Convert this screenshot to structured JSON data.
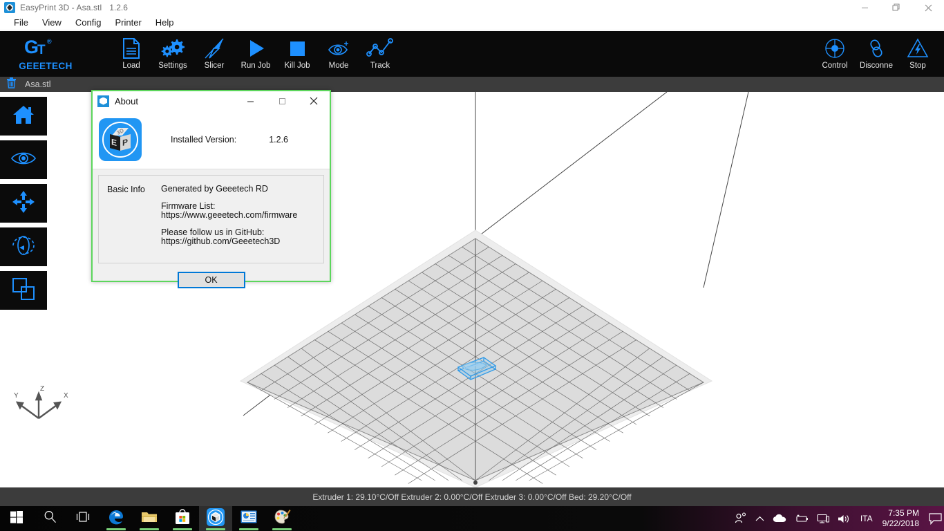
{
  "window": {
    "title": "EasyPrint 3D - Asa.stl",
    "version": "1.2.6",
    "minimize": "—",
    "maximize": "❐",
    "close": "✕"
  },
  "menubar": {
    "items": [
      {
        "label": "File"
      },
      {
        "label": "View"
      },
      {
        "label": "Config"
      },
      {
        "label": "Printer"
      },
      {
        "label": "Help"
      }
    ]
  },
  "brand": {
    "mark": "G",
    "mark_sub": "T",
    "registered": "®",
    "name": "GEEETECH"
  },
  "toolbar": {
    "left_tools": [
      {
        "label": "Load",
        "icon": "document-icon"
      },
      {
        "label": "Settings",
        "icon": "gears-icon"
      },
      {
        "label": "Slicer",
        "icon": "slice-knife-icon"
      },
      {
        "label": "Run Job",
        "icon": "play-icon"
      },
      {
        "label": "Kill Job",
        "icon": "stop-square-icon"
      },
      {
        "label": "Mode",
        "icon": "eye-icon"
      },
      {
        "label": "Track",
        "icon": "track-graph-icon"
      }
    ],
    "right_tools": [
      {
        "label": "Control",
        "icon": "control-dial-icon"
      },
      {
        "label": "Disconne",
        "icon": "chain-link-icon"
      },
      {
        "label": "Stop",
        "icon": "warning-bolt-icon"
      }
    ]
  },
  "filetab": {
    "name": "Asa.stl",
    "delete_icon": "trash-icon"
  },
  "sidebar": {
    "items": [
      {
        "name": "home",
        "icon": "home-icon"
      },
      {
        "name": "view",
        "icon": "eye-icon"
      },
      {
        "name": "move",
        "icon": "move-arrows-icon"
      },
      {
        "name": "rotate",
        "icon": "rotate-icon"
      },
      {
        "name": "scale",
        "icon": "scale-squares-icon"
      }
    ]
  },
  "viewport": {
    "axis_labels": {
      "x": "X",
      "y": "Y",
      "z": "Z"
    },
    "plate_color": "#dcdcdc",
    "grid_color": "#5a5a5a",
    "model_color": "#2f9ae8"
  },
  "statusbar": {
    "text": "Extruder 1: 29.10°C/Off Extruder 2: 0.00°C/Off Extruder 3: 0.00°C/Off Bed: 29.20°C/Off"
  },
  "dialog": {
    "title": "About",
    "minimize": "—",
    "maximize": "☐",
    "close": "✕",
    "version_label": "Installed Version:",
    "version_value": "1.2.6",
    "basic_info_label": "Basic Info",
    "generated_by": "Generated by Geeetech RD",
    "firmware_heading": "Firmware List:",
    "firmware_url": "https://www.geeetech.com/firmware",
    "github_heading": "Please follow us in GitHub:",
    "github_url": "https://github.com/Geeetech3D",
    "ok_label": "OK",
    "icon_letters": {
      "top": "3D",
      "left": "E",
      "right": "P"
    },
    "border_color": "#5cd65c"
  },
  "taskbar": {
    "items": [
      {
        "name": "start",
        "icon": "windows-logo-icon",
        "running": false,
        "active": false
      },
      {
        "name": "search",
        "icon": "magnifier-icon",
        "running": false,
        "active": false
      },
      {
        "name": "task-view",
        "icon": "task-view-icon",
        "running": false,
        "active": false
      },
      {
        "name": "edge",
        "icon": "edge-icon",
        "running": true,
        "active": false
      },
      {
        "name": "file-explorer",
        "icon": "folder-icon",
        "running": true,
        "active": false
      },
      {
        "name": "store",
        "icon": "store-icon",
        "running": true,
        "active": false
      },
      {
        "name": "easyprint3d",
        "icon": "easyprint-cube-icon",
        "running": true,
        "active": true
      },
      {
        "name": "presentation",
        "icon": "presentation-icon",
        "running": true,
        "active": false
      },
      {
        "name": "paint",
        "icon": "paint-palette-icon",
        "running": true,
        "active": false
      }
    ],
    "tray": {
      "icons": [
        {
          "name": "people-icon",
          "glyph": "people"
        },
        {
          "name": "show-hidden-icons-chevron",
          "glyph": "chevron-up"
        },
        {
          "name": "onedrive-icon",
          "glyph": "cloud"
        },
        {
          "name": "battery-icon",
          "glyph": "battery"
        },
        {
          "name": "network-icon",
          "glyph": "monitor"
        },
        {
          "name": "volume-icon",
          "glyph": "speaker"
        }
      ],
      "language": "ITA",
      "time": "7:35 PM",
      "date": "9/22/2018",
      "action_center": "notification-icon"
    }
  }
}
